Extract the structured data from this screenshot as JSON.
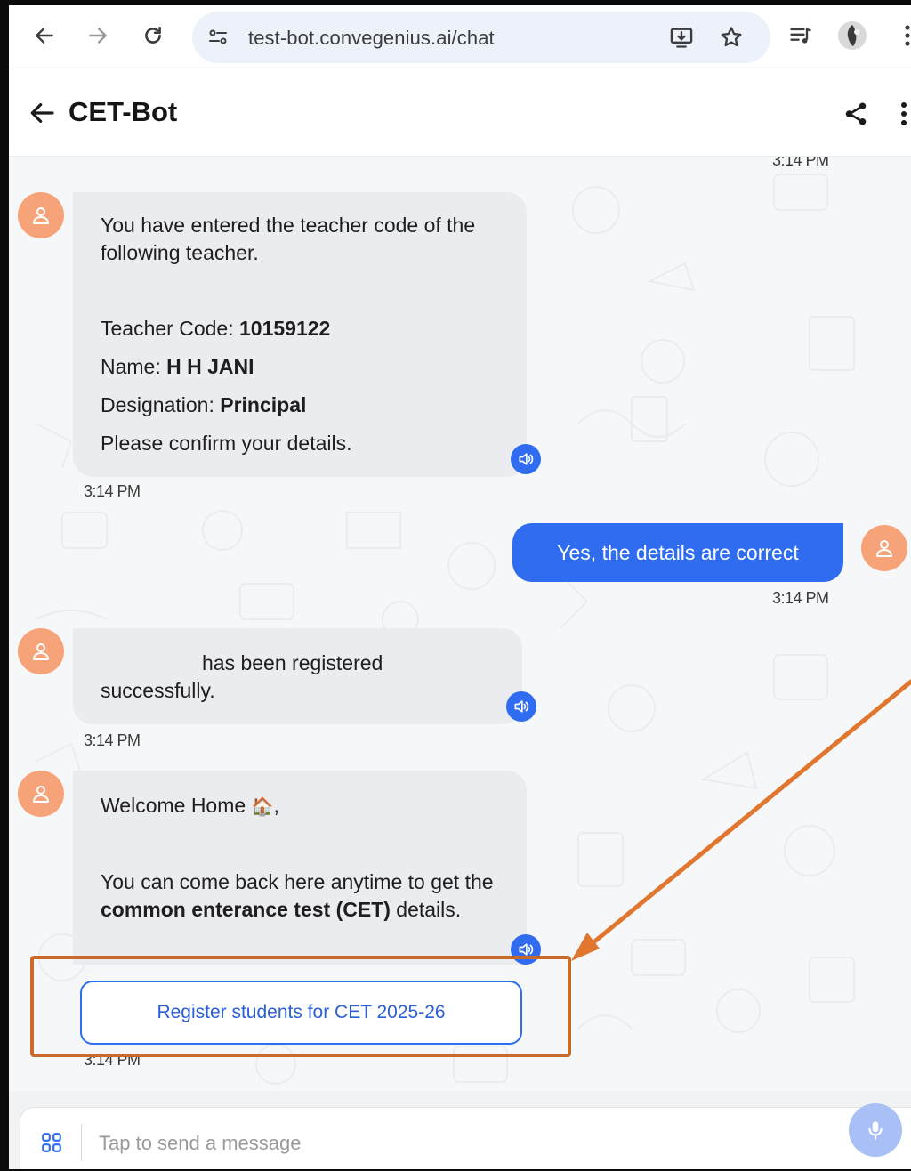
{
  "browser": {
    "url": "test-bot.convegenius.ai/chat"
  },
  "header": {
    "title": "CET-Bot"
  },
  "chat": {
    "top_partial_time": "3:14 PM",
    "msg1": {
      "intro": "You have entered the teacher code of the following teacher.",
      "code_label": "Teacher Code: ",
      "code_value": "10159122",
      "name_label": "Name: ",
      "name_value": "H H JANI",
      "designation_label": "Designation: ",
      "designation_value": "Principal",
      "confirm": "Please confirm your details.",
      "time": "3:14 PM"
    },
    "reply": {
      "text": "Yes, the details are correct",
      "time": "3:14 PM"
    },
    "msg2": {
      "line1": "has been registered",
      "line2": "successfully.",
      "time": "3:14 PM"
    },
    "msg3": {
      "greeting": "Welcome Home",
      "house_emoji": "🏠",
      "comma": ",",
      "body_pre": "You can come back here anytime to get the ",
      "body_bold": "common enterance test (CET)",
      "body_post": " details.",
      "time": "3:14 PM"
    },
    "action_button": "Register students for CET 2025-26"
  },
  "composer": {
    "placeholder": "Tap to send a message"
  },
  "colors": {
    "accent": "#2f6cf0",
    "avatar": "#f7a37a",
    "highlight": "#c86a2c"
  },
  "icons": [
    "back-arrow-icon",
    "forward-arrow-icon",
    "reload-icon",
    "site-settings-icon",
    "install-icon",
    "star-icon",
    "media-icon",
    "profile-icon",
    "menu-icon",
    "share-icon",
    "more-icon",
    "user-icon",
    "speaker-icon",
    "grid-icon",
    "mic-icon"
  ]
}
